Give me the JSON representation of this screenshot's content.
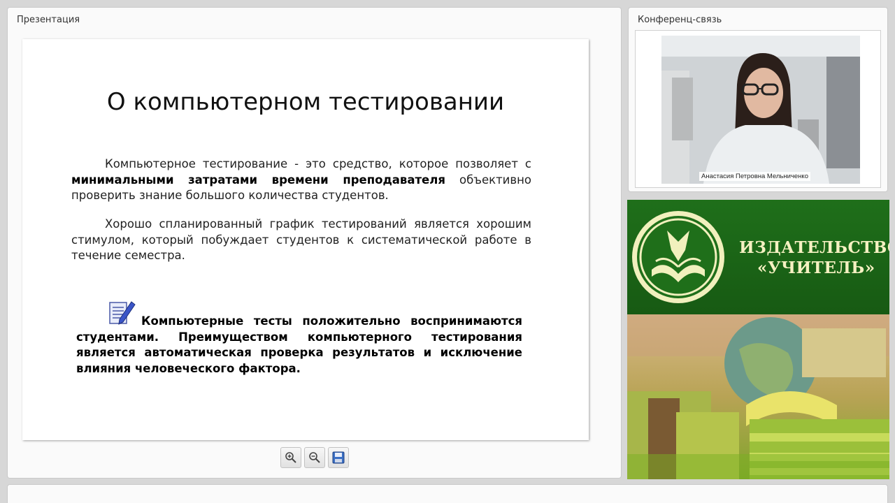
{
  "presentation": {
    "title": "Презентация",
    "slide": {
      "heading": "О компьютерном тестировании",
      "p1_a": "Компьютерное тестирование - это средство, которое позволяет с ",
      "p1_b": "минимальными затратами времени преподавателя",
      "p1_c": " объективно проверить знание большого количества студентов.",
      "p2": "Хорошо спланированный график тестирований является хорошим стимулом, который побуждает студентов к систематической работе в течение семестра.",
      "p3": "Компьютерные тесты положительно воспринимаются студентами. Преимуществом компьютерного тестирования является автоматическая проверка результатов и исключение влияния человеческого фактора."
    },
    "toolbar": [
      "zoom-in-icon",
      "zoom-out-icon",
      "save-icon"
    ]
  },
  "conference": {
    "title": "Конференц-связь",
    "participant_name": "Анастасия Петровна Мельниченко"
  },
  "banner": {
    "line1": "ИЗДАТЕЛЬСТВО",
    "line2": "«УЧИТЕЛЬ»"
  },
  "colors": {
    "banner_green": "#1f6f1a",
    "banner_text": "#f6f1c2"
  }
}
